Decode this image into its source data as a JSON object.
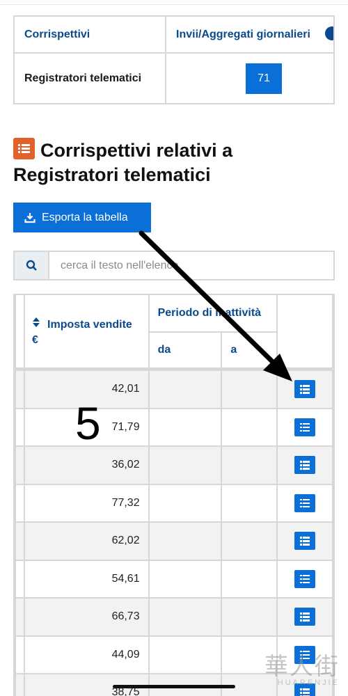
{
  "summary": {
    "col_header_1": "Corrispettivi",
    "col_header_2": "Invii/Aggregati giornalieri",
    "row_label": "Registratori telematici",
    "row_count": "71"
  },
  "section": {
    "title": "Corrispettivi relativi a Registratori telematici",
    "icon": "list-icon"
  },
  "export_button": {
    "label": "Esporta la tabella",
    "icon": "download-icon"
  },
  "search": {
    "placeholder": "cerca il testo nell'elenco",
    "icon": "search-icon"
  },
  "table": {
    "header_amount_line1": "Imposta vendite",
    "header_amount_line2": "€",
    "header_period": "Periodo di inattività",
    "header_from": "da",
    "header_to": "a",
    "rows": [
      {
        "amount": "42,01"
      },
      {
        "amount": "71,79"
      },
      {
        "amount": "36,02"
      },
      {
        "amount": "77,32"
      },
      {
        "amount": "62,02"
      },
      {
        "amount": "54,61"
      },
      {
        "amount": "66,73"
      },
      {
        "amount": "44,09"
      },
      {
        "amount": "38,75"
      }
    ]
  },
  "annotation": {
    "number": "5"
  },
  "watermark": {
    "chinese": "華人街",
    "latin": "HUARENJIE"
  },
  "colors": {
    "primary": "#0a6fd6",
    "heading": "#0a4a8c",
    "accent": "#e2612b",
    "border": "#d7d7d7"
  }
}
